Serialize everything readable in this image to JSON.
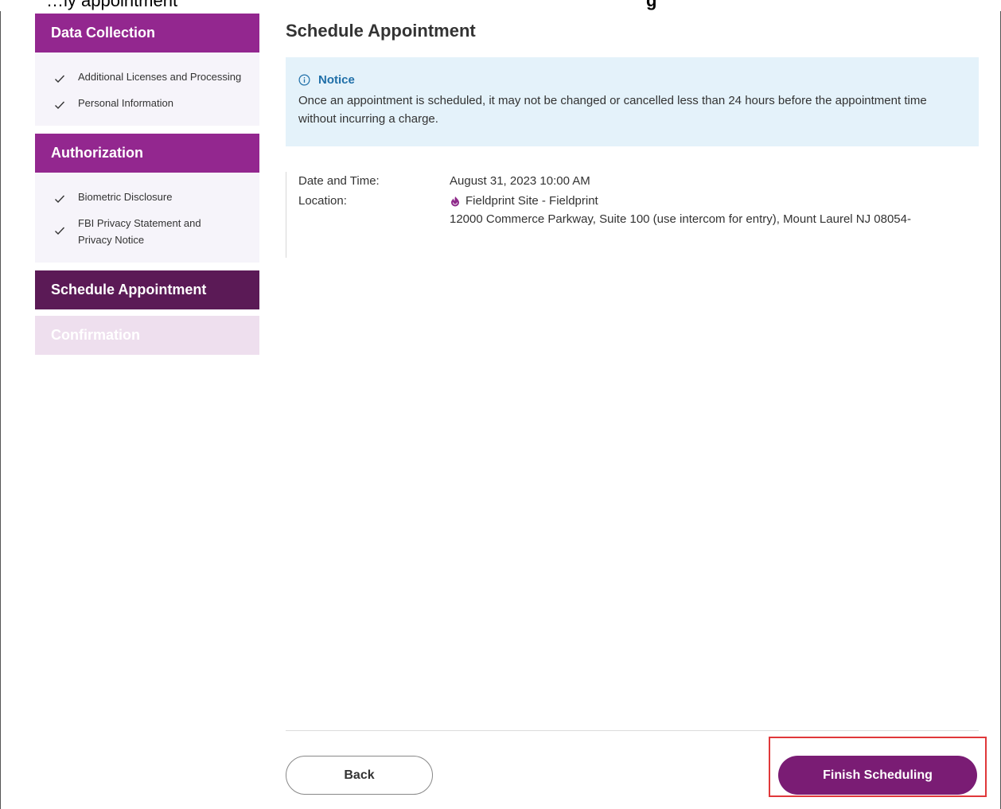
{
  "top_strip": {
    "cut_text_left": "…ly appointment",
    "cut_text_right": "g"
  },
  "sidebar": {
    "sections": [
      {
        "title": "Data Collection",
        "steps": [
          "Additional Licenses and Processing",
          "Personal Information"
        ]
      },
      {
        "title": "Authorization",
        "steps": [
          "Biometric Disclosure",
          "FBI Privacy Statement and Privacy Notice"
        ]
      }
    ],
    "current": "Schedule Appointment",
    "upcoming": "Confirmation"
  },
  "main": {
    "title": "Schedule Appointment",
    "notice": {
      "heading": "Notice",
      "body": "Once an appointment is scheduled, it may not be changed or cancelled less than 24 hours before the appointment time without incurring a charge."
    },
    "details": {
      "date_label": "Date and Time:",
      "date_value": "August 31, 2023 10:00 AM",
      "location_label": "Location:",
      "location_name": "Fieldprint Site - Fieldprint",
      "location_address": "12000 Commerce Parkway, Suite 100 (use intercom for entry), Mount Laurel NJ 08054-"
    },
    "buttons": {
      "back": "Back",
      "finish": "Finish Scheduling"
    }
  },
  "colors": {
    "section_header": "#93278f",
    "current_header": "#5b1a56",
    "upcoming_header": "#eedfee",
    "notice_bg": "#e4f2fa",
    "primary_button": "#7a1c74",
    "highlight": "#e0383a"
  }
}
